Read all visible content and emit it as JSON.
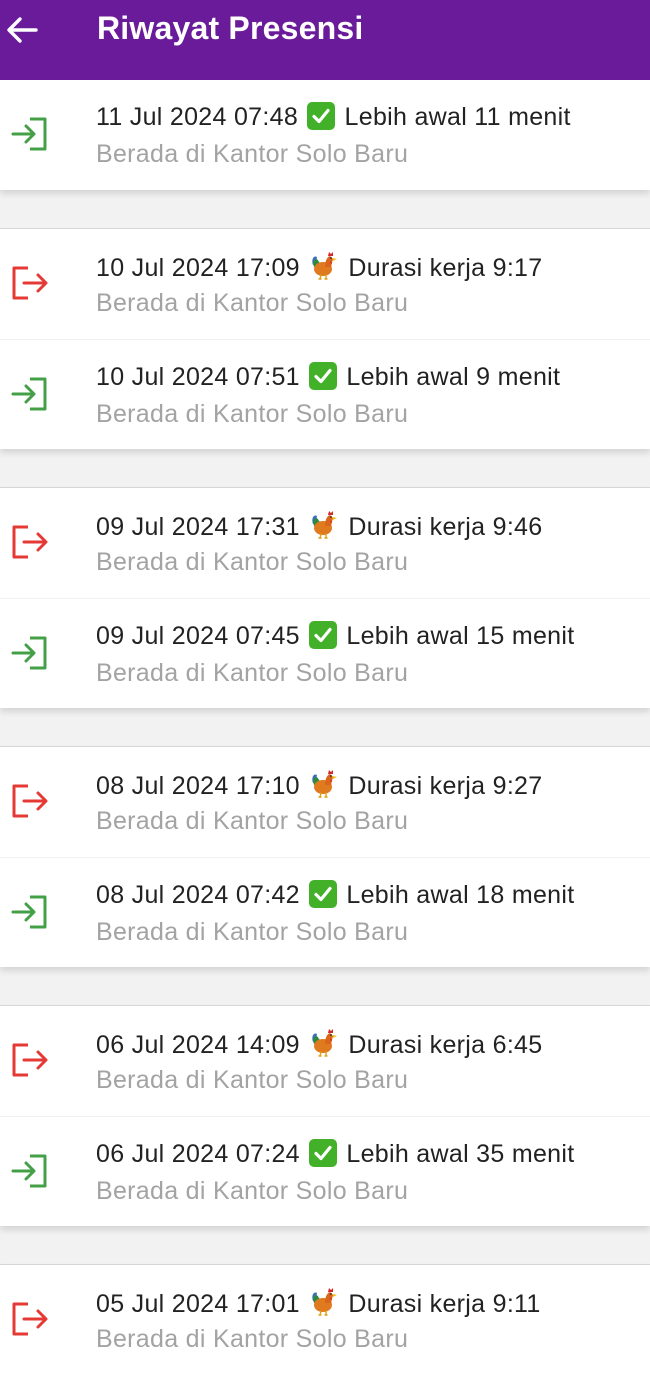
{
  "header": {
    "title": "Riwayat Presensi",
    "back_icon": "arrow-left-icon"
  },
  "colors": {
    "appbar": "#6a1b9a",
    "check_in": "#43a047",
    "check_out": "#e53935",
    "check_badge": "#43b02a"
  },
  "groups": [
    {
      "entries": [
        {
          "type": "in",
          "date": "11 Jul 2024 07:48",
          "emoji": "check-mark-icon",
          "status": "Lebih awal 11 menit",
          "location": "Berada di Kantor Solo Baru"
        }
      ]
    },
    {
      "entries": [
        {
          "type": "out",
          "date": "10 Jul 2024 17:09",
          "emoji": "rooster-icon",
          "status": "Durasi kerja 9:17",
          "location": "Berada di Kantor Solo Baru"
        },
        {
          "type": "in",
          "date": "10 Jul 2024 07:51",
          "emoji": "check-mark-icon",
          "status": "Lebih awal 9 menit",
          "location": "Berada di Kantor Solo Baru"
        }
      ]
    },
    {
      "entries": [
        {
          "type": "out",
          "date": "09 Jul 2024 17:31",
          "emoji": "rooster-icon",
          "status": "Durasi kerja 9:46",
          "location": "Berada di Kantor Solo Baru"
        },
        {
          "type": "in",
          "date": "09 Jul 2024 07:45",
          "emoji": "check-mark-icon",
          "status": "Lebih awal 15 menit",
          "location": "Berada di Kantor Solo Baru"
        }
      ]
    },
    {
      "entries": [
        {
          "type": "out",
          "date": "08 Jul 2024 17:10",
          "emoji": "rooster-icon",
          "status": "Durasi kerja 9:27",
          "location": "Berada di Kantor Solo Baru"
        },
        {
          "type": "in",
          "date": "08 Jul 2024 07:42",
          "emoji": "check-mark-icon",
          "status": "Lebih awal 18 menit",
          "location": "Berada di Kantor Solo Baru"
        }
      ]
    },
    {
      "entries": [
        {
          "type": "out",
          "date": "06 Jul 2024 14:09",
          "emoji": "rooster-icon",
          "status": "Durasi kerja 6:45",
          "location": "Berada di Kantor Solo Baru"
        },
        {
          "type": "in",
          "date": "06 Jul 2024 07:24",
          "emoji": "check-mark-icon",
          "status": "Lebih awal 35 menit",
          "location": "Berada di Kantor Solo Baru"
        }
      ]
    },
    {
      "entries": [
        {
          "type": "out",
          "date": "05 Jul 2024 17:01",
          "emoji": "rooster-icon",
          "status": "Durasi kerja 9:11",
          "location": "Berada di Kantor Solo Baru"
        }
      ]
    }
  ]
}
